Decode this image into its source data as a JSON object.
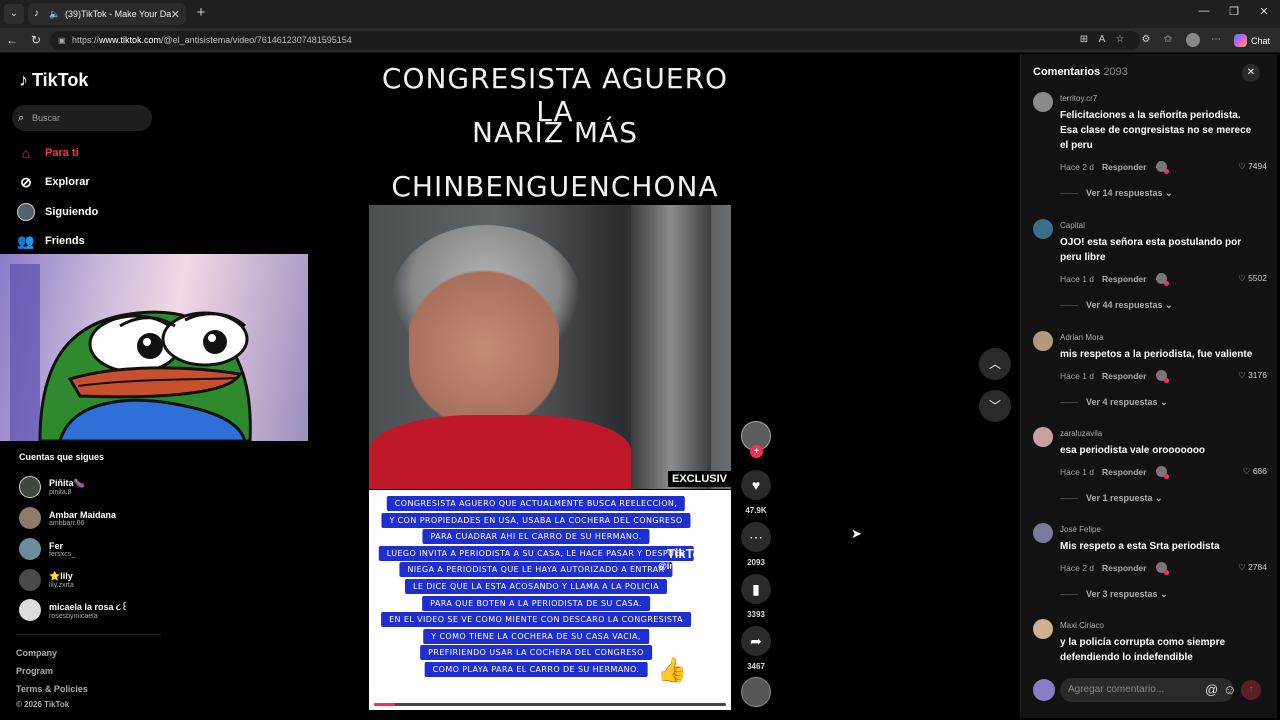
{
  "browser": {
    "tab_title": "(39)TikTok - Make Your Day",
    "url_prefix": "https://",
    "url_domain": "www.tiktok.com",
    "url_path": "/@el_antisistema/video/7614612307481595154",
    "chat_label": "Chat"
  },
  "sidebar": {
    "logo": "TikTok",
    "search_placeholder": "Buscar",
    "nav": [
      {
        "label": "Para ti",
        "icon": "home-icon"
      },
      {
        "label": "Explorar",
        "icon": "compass-icon"
      },
      {
        "label": "Siguiendo",
        "icon": "following-avatar"
      },
      {
        "label": "Friends",
        "icon": "friends-icon"
      }
    ],
    "following_title": "Cuentas que sigues",
    "following": [
      {
        "name": "Piñita🍆",
        "user": "pinita.8"
      },
      {
        "name": "Ambar Maidana",
        "user": "ambbarr.06"
      },
      {
        "name": "Fer",
        "user": "fersxcs_"
      },
      {
        "name": "⭐lily",
        "user": "lily.zxrta"
      },
      {
        "name": "micaela la rosa ૮꒰",
        "user": "rosesbymicaela"
      }
    ],
    "footer": [
      "Company",
      "Program",
      "Terms & Policies"
    ],
    "copyright": "© 2026 TikTok"
  },
  "video": {
    "title_lines": [
      "CONGRESISTA AGUERO LA",
      "NARIZ MÁS",
      "CHINBENGUENCHONA"
    ],
    "exclusive_label": "EXCLUSIV",
    "caption_lines": [
      "CONGRESISTA AGUERO QUE ACTUALMENTE BUSCA REELECCION,",
      "Y CON PROPIEDADES EN USA, USABA LA COCHERA DEL CONGRESO",
      "PARA CUADRAR AHI EL CARRO DE SU HERMANO.",
      "LUEGO INVITA A PERIODISTA A SU CASA, LE HACE PASAR Y DESPUES",
      "NIEGA A PERIODISTA QUE LE HAYA AUTORIZADO A ENTRAR",
      "LE DICE QUE LA ESTA ACOSANDO Y LLAMA A LA POLICIA",
      "PARA QUE BOTEN A LA PERIODISTA DE SU CASA.",
      "EN EL VIDEO SE VE COMO MIENTE CON DESCARO LA CONGRESISTA",
      "Y COMO TIENE LA COCHERA DE SU CASA VACIA,",
      "PREFIRIENDO USAR LA COCHERA DEL CONGRESO",
      "COMO PLAYA PARA EL CARRO DE SU HERMANO."
    ],
    "watermark_logo": "TikTok",
    "watermark_user": "@ingrid_0872",
    "author": "el_antisistema",
    "progress": 0.06
  },
  "actions": {
    "likes": "47.9K",
    "comments": "2093",
    "saves": "3393",
    "shares": "3467"
  },
  "comments_panel": {
    "title": "Comentarios",
    "count": "2093",
    "input_placeholder": "Agregar comentario...",
    "reply_label": "Responder",
    "items": [
      {
        "user": "territoy.cr7",
        "text": "Felicitaciones a la señorita periodista. Esa clase de congresistas no se merece el peru",
        "time": "Hace 2 d",
        "likes": "7494",
        "more": "Ver 14 respuestas"
      },
      {
        "user": "Capital",
        "text": "OJO! esta señora esta postulando por peru libre",
        "time": "Hace 1 d",
        "likes": "5502",
        "more": "Ver 44 respuestas"
      },
      {
        "user": "Adrian Mora",
        "text": "mis respetos a la periodista, fue valiente",
        "time": "Hace 1 d",
        "likes": "3176",
        "more": "Ver 4 respuestas"
      },
      {
        "user": "zaraluzavila",
        "text": "esa periodista vale orooooooo",
        "time": "Hace 1 d",
        "likes": "686",
        "more": "Ver 1 respuesta"
      },
      {
        "user": "José Felipe",
        "text": "Mis respeto a esta Srta periodista",
        "time": "Hace 2 d",
        "likes": "2784",
        "more": "Ver 3 respuestas"
      },
      {
        "user": "Maxi Ciriaco",
        "text": "y la policía corrupta como siempre defendiendo lo indefendible",
        "time": "",
        "likes": "",
        "more": ""
      }
    ]
  }
}
